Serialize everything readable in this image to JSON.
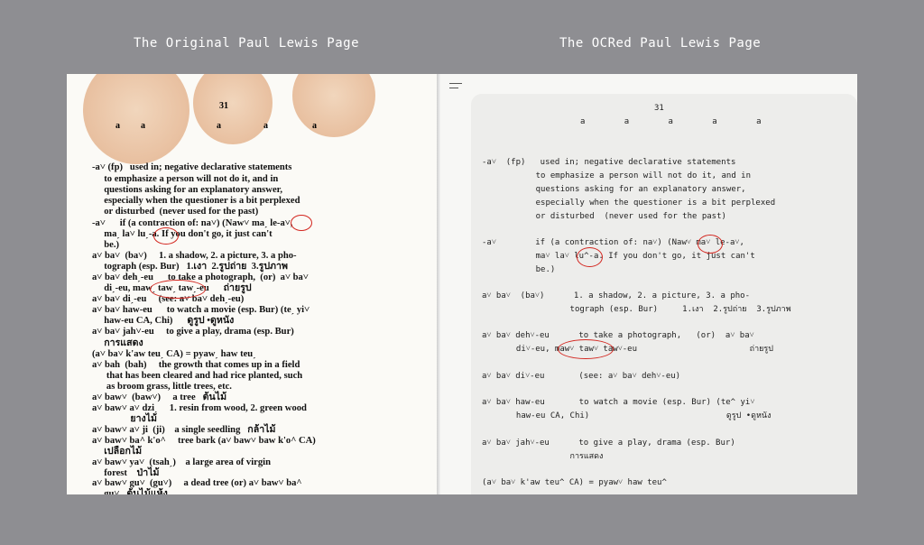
{
  "captions": {
    "left": "The Original Paul Lewis Page",
    "right": "The OCRed Paul Lewis Page"
  },
  "scan": {
    "page_number": "31",
    "header_letters": [
      "a",
      "a",
      "a",
      "a",
      "a"
    ],
    "lines": [
      "-a˅ (fp)   used in; negative declarative statements",
      "     to emphasize a person will not do it, and in",
      "     questions asking for an explanatory answer,",
      "     especially when the questioner is a bit perplexed",
      "     or disturbed  (never used for the past)",
      "-a˅      if (a contraction of: na˅) (Naw˅ maˏ le-a˅,",
      "     maˏ la˅ luˏ-a. If you don't go, it just can't",
      "     be.)",
      "a˅ ba˅  (ba˅)     1. a shadow, 2. a picture, 3. a pho-",
      "     tograph (esp. Bur)   1.เงา  2.รูปถ่าย  3.รูปภาพ",
      "a˅ ba˅ dehˏ-eu      to take a photograph,  (or)  a˅ ba˅",
      "     diˏ-eu, mawˏ tawˏ tawˏ-eu      ถ่ายรูป",
      "a˅ ba˅ diˏ-eu     (see: a˅ ba˅ dehˏ-eu)",
      "a˅ ba˅ haw-eu      to watch a movie (esp. Bur) (teˏ yi˅",
      "     haw-eu CA, Chi)      ดูรูป •ดูหนัง",
      "a˅ ba˅ jah˅-eu     to give a play, drama (esp. Bur)",
      "     การแสดง",
      "(a˅ ba˅ k'aw teuˏ CA) = pyawˏ haw teuˏ",
      "a˅ bah  (bah)     the growth that comes up in a field",
      "      that has been cleared and had rice planted, such",
      "      as broom grass, little trees, etc.",
      "a˅ baw˅  (baw˅)     a tree   ต้นไม้",
      "a˅ baw˅ a˅ dziˏ     1. resin from wood, 2. green wood",
      "                ยางไม้",
      "a˅ baw˅ a˅ ji  (ji)    a single seedling   กล้าไม้",
      "a˅ baw˅ ba^ k'o^     tree bark (a˅ baw˅ baw k'o^ CA)",
      "     เปลือกไม้",
      "a˅ baw˅ ya˅  (tsahˏ)    a large area of virgin",
      "     forest    ป่าไม้",
      "a˅ baw˅ gu˅  (gu˅)     a dead tree (or) a˅ baw˅ ba^",
      "     gu˅   ต้นไม้แห้ง"
    ]
  },
  "ocr": {
    "menu_icon": "hamburger-menu-icon",
    "page_number": "31",
    "header_letters": "a        a        a        a        a",
    "lines": [
      "-a˅  (fp)   used in; negative declarative statements",
      "           to emphasize a person will not do it, and in",
      "           questions asking for an explanatory answer,",
      "           especially when the questioner is a bit perplexed",
      "           or disturbed  (never used for the past)",
      "-a˅        if (a contraction of: na˅) (Naw˅ ma˅ le-a˅,",
      "           ma˅ la˅ lu^-a. If you don't go, it just can't",
      "           be.)",
      "a˅ ba˅  (ba˅)      1. a shadow, 2. a picture, 3. a pho-",
      "                  tograph (esp. Bur)     1.เงา  2.รูปถ่าย  3.รูปภาพ",
      "a˅ ba˅ deh˅-eu      to take a photograph,   (or)  a˅ ba˅",
      "       di˅-eu, maw˅ taw˅ taw˅-eu                       ถ่ายรูป",
      "a˅ ba˅ di˅-eu       (see: a˅ ba˅ deh˅-eu)",
      "a˅ ba˅ haw-eu       to watch a movie (esp. Bur) (te^ yi˅",
      "       haw-eu CA, Chi)                            ดูรูป •ดูหนัง",
      "a˅ ba˅ jah˅-eu      to give a play, drama (esp. Bur)",
      "                  การแสดง",
      "(a˅ ba˅ k'aw teu^ CA) = pyaw˅ haw teu^"
    ]
  },
  "colors": {
    "background": "#8e8e92",
    "annotation": "#d3261f",
    "card": "#ededeb"
  }
}
